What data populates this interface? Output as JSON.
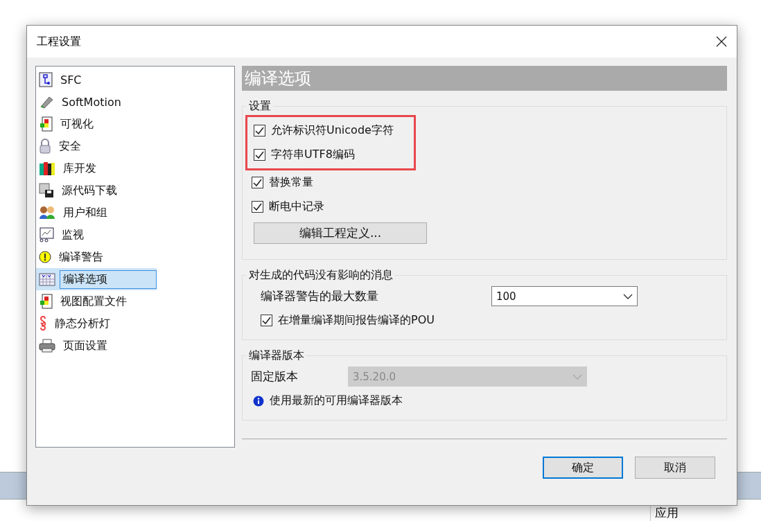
{
  "window": {
    "title": "工程设置"
  },
  "sidebar": {
    "items": [
      {
        "label": "SFC",
        "selected": false
      },
      {
        "label": "SoftMotion",
        "selected": false
      },
      {
        "label": "可视化",
        "selected": false
      },
      {
        "label": "安全",
        "selected": false
      },
      {
        "label": "库开发",
        "selected": false
      },
      {
        "label": "源代码下载",
        "selected": false
      },
      {
        "label": "用户和组",
        "selected": false
      },
      {
        "label": "监视",
        "selected": false
      },
      {
        "label": "编译警告",
        "selected": false
      },
      {
        "label": "编译选项",
        "selected": true
      },
      {
        "label": "视图配置文件",
        "selected": false
      },
      {
        "label": "静态分析灯",
        "selected": false
      },
      {
        "label": "页面设置",
        "selected": false
      }
    ]
  },
  "page": {
    "title": "编译选项",
    "groups": [
      {
        "title": "设置",
        "rows": [
          {
            "kind": "checkbox",
            "label": "允许标识符Unicode字符",
            "checked": true,
            "highlighted": true
          },
          {
            "kind": "checkbox",
            "label": "字符串UTF8编码",
            "checked": true,
            "highlighted": true
          },
          {
            "kind": "checkbox",
            "label": "替换常量",
            "checked": true,
            "highlighted": false
          },
          {
            "kind": "checkbox",
            "label": "断电中记录",
            "checked": true,
            "highlighted": false
          },
          {
            "kind": "button",
            "label": "编辑工程定义..."
          }
        ]
      },
      {
        "title": "对生成的代码没有影响的消息",
        "rows": [
          {
            "kind": "select",
            "label": "编译器警告的最大数量",
            "value": "100",
            "disabled": false
          },
          {
            "kind": "checkbox",
            "label": "在增量编译期间报告编译的POU",
            "checked": true,
            "highlighted": false
          }
        ]
      },
      {
        "title": "编译器版本",
        "rows": [
          {
            "kind": "select",
            "label": "固定版本",
            "value": "3.5.20.0",
            "disabled": true
          },
          {
            "kind": "info",
            "label": "使用最新的可用编译器版本"
          }
        ]
      }
    ]
  },
  "buttons": [
    {
      "label": "确定",
      "default": true
    },
    {
      "label": "取消",
      "default": false
    }
  ],
  "background": {
    "label": "应用"
  }
}
